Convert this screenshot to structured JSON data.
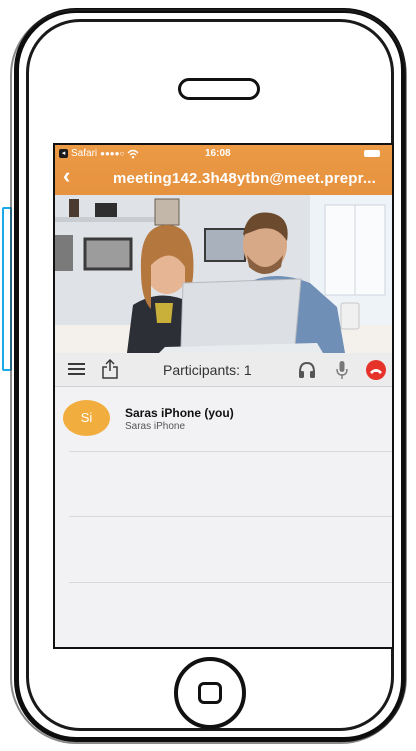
{
  "status_bar": {
    "carrier": "Safari",
    "signal": "●●●●○",
    "wifi_icon": "wifi-icon",
    "time": "16:08",
    "battery_icon": "battery-icon"
  },
  "nav": {
    "back_icon": "chevron-left-icon",
    "title": "meeting142.3h48ytbn@meet.prepr..."
  },
  "toolbar": {
    "menu_icon": "hamburger-icon",
    "share_icon": "share-icon",
    "participants_label": "Participants: 1",
    "headset_icon": "headset-icon",
    "mic_icon": "microphone-icon",
    "hangup_icon": "hang-up-icon"
  },
  "participants": [
    {
      "initials": "Si",
      "name": "Saras iPhone (you)",
      "device": "Saras iPhone"
    }
  ],
  "colors": {
    "nav_bar": "#e6923f",
    "avatar": "#f2ad3f",
    "hangup": "#e6332a",
    "accent_stroke": "#19a9e6"
  }
}
